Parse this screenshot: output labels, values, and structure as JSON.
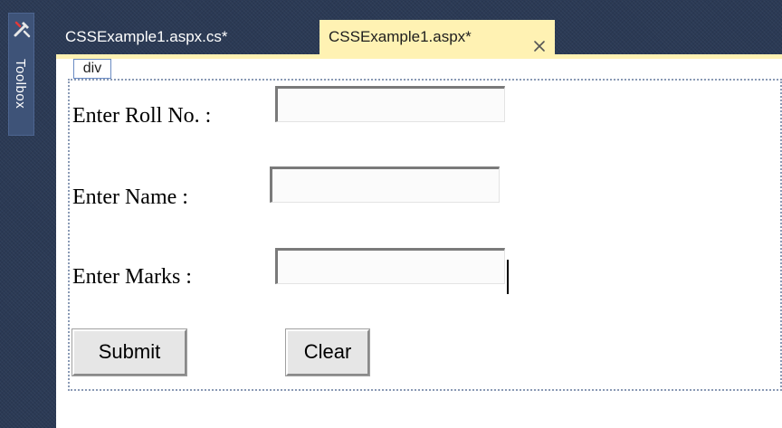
{
  "toolbox": {
    "label": "Toolbox",
    "icon": "toolbox-icon"
  },
  "tabs": [
    {
      "label": "CSSExample1.aspx.cs*",
      "active": false
    },
    {
      "label": "CSSExample1.aspx*",
      "active": true,
      "close_icon": "close-icon"
    }
  ],
  "designer": {
    "element_tag": "div",
    "form": {
      "roll_label": "Enter Roll No. :",
      "roll_value": "",
      "name_label": "Enter Name :",
      "name_value": "",
      "marks_label": "Enter Marks :",
      "marks_value": "",
      "submit_label": "Submit",
      "clear_label": "Clear"
    }
  },
  "colors": {
    "ide_background": "#2b3a55",
    "active_tab": "#fff2b3",
    "selection_border": "#6a8bc3"
  }
}
